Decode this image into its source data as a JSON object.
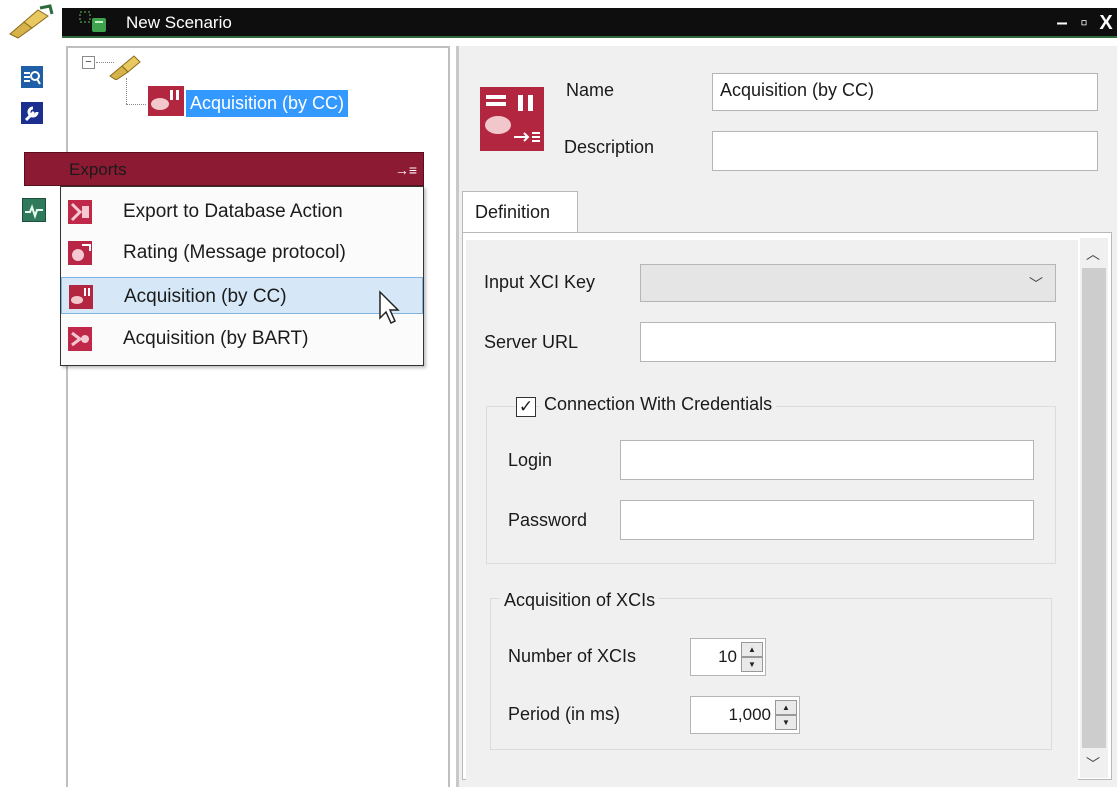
{
  "window": {
    "title": "New Scenario",
    "controls": [
      "–",
      "▫",
      "X"
    ]
  },
  "tree": {
    "expander": "−",
    "selected_node": "Acquisition (by CC)"
  },
  "popup": {
    "header": "Exports",
    "pin_glyph": "→≡",
    "items": [
      {
        "label": "Export to Database Action",
        "icon": "database-export-icon"
      },
      {
        "label": "Rating (Message protocol)",
        "icon": "rating-icon"
      },
      {
        "label": "Acquisition (by CC)",
        "icon": "acquisition-cc-icon",
        "hovered": true
      },
      {
        "label": "Acquisition (by BART)",
        "icon": "acquisition-bart-icon"
      }
    ]
  },
  "properties": {
    "name_label": "Name",
    "name_value": "Acquisition (by CC)",
    "description_label": "Description",
    "description_value": "",
    "tab": "Definition",
    "input_xci_key_label": "Input XCI Key",
    "input_xci_key_value": "",
    "server_url_label": "Server URL",
    "server_url_value": "",
    "credentials_label": "Connection With Credentials",
    "credentials_checked": true,
    "login_label": "Login",
    "login_value": "",
    "password_label": "Password",
    "password_value": "",
    "acquisition_group_label": "Acquisition of XCIs",
    "number_of_xcis_label": "Number of XCIs",
    "number_of_xcis_value": "10",
    "period_label": "Period (in ms)",
    "period_value": "1,000"
  },
  "colors": {
    "accent": "#8c1a33",
    "selection": "#3399ff",
    "menu_hover": "#d6e8f7"
  }
}
